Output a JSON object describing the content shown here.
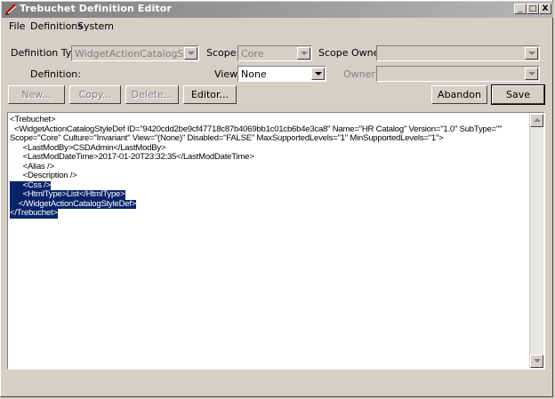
{
  "window": {
    "title": "Trebuchet Definition Editor",
    "controls": [
      "_",
      "□",
      "X"
    ]
  },
  "menu": {
    "items": [
      "File",
      "Definitions",
      "System"
    ]
  },
  "form": {
    "definition_type_label": "Definition Type:",
    "definition_type_value": "WidgetActionCatalogStyleDef",
    "scope_label": "Scope:",
    "scope_value": "Core",
    "scope_owner_label": "Scope Owner:",
    "scope_owner_value": "",
    "definition_label": "Definition:",
    "view_label": "View:",
    "view_value": "None",
    "owner_label": "Owner:",
    "owner_value": ""
  },
  "buttons": {
    "new": "New...",
    "copy": "Copy...",
    "delete": "Delete...",
    "editor": "Editor...",
    "abandon": "Abandon",
    "save": "Save"
  },
  "editor": {
    "lines": [
      "<Trebuchet>",
      "  <WidgetActionCatalogStyleDef ID=\"9420cdd2be9cf47718c87b4069bb1c01cb6b4e3ca8\" Name=\"HR Catalog\" Version=\"1.0\" SubType=\"\"",
      "Scope=\"Core\" Culture=\"Invariant\" View=\"(None)\" Disabled=\"FALSE\" MaxSupportedLevels=\"1\" MinSupportedLevels=\"1\">",
      "      <LastModBy>CSDAdmin</LastModBy>",
      "      <LastModDateTime>2017-01-20T23:32:35</LastModDateTime>",
      "      <Alias />",
      "      <Description />",
      "      <Css />",
      "      <HtmlType>List</HtmlType>",
      "    </WidgetActionCatalogStyleDef>",
      "</Trebuchet>"
    ],
    "selected_from_line": 7
  }
}
